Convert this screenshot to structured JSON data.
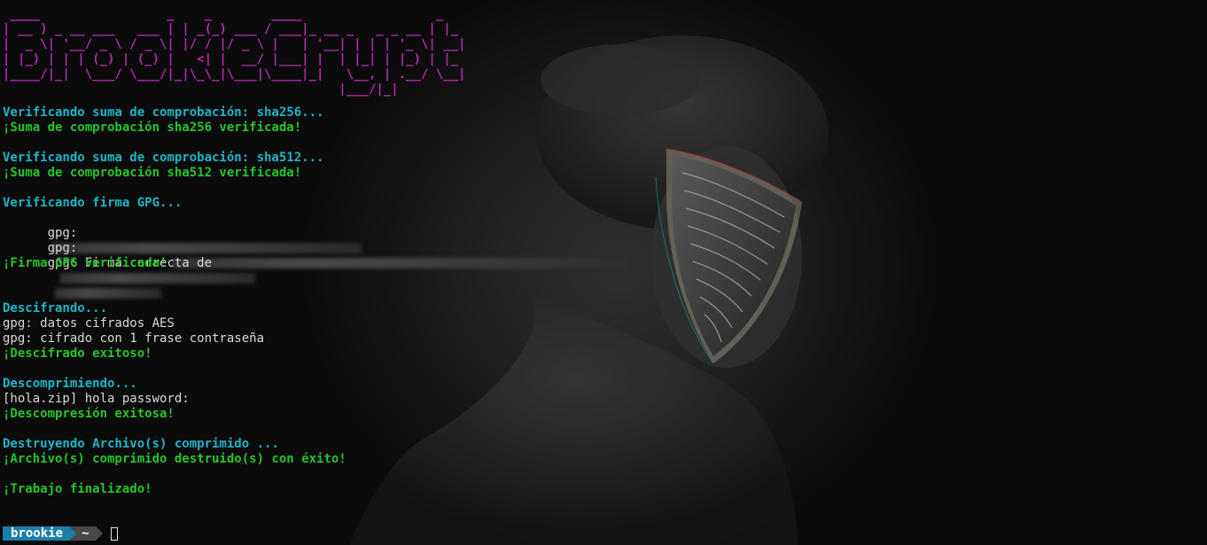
{
  "banner_art": " ____                 _    _        ____                  _\n| __ ) _ __ ___   ___ | | _(_) ___ / ___|_ __ _   _ _ __ | |_\n|  _ \\| '__/ _ \\ / _ \\| |/ / |/ _ \\ |   | '__| | | | '_ \\| __|\n| |_) | | | (_) | (_) |   <| |  __/ |___| |  | |_| | |_) | |_\n|____/|_|  \\___/ \\___/|_|\\_\\_|\\___|\\____|_|   \\__, | .__/ \\__|\n                                             |___/|_|",
  "lines": {
    "sha256_checking": "Verificando suma de comprobación: sha256...",
    "sha256_ok": "¡Suma de comprobación sha256 verificada!",
    "sha512_checking": "Verificando suma de comprobación: sha512...",
    "sha512_ok": "¡Suma de comprobación sha512 verificada!",
    "gpg_checking": "Verificando firma GPG...",
    "gpg_prefix_1": "gpg:",
    "gpg_prefix_2": "gpg:",
    "gpg_good_sig": "gpg: Firma correcta de",
    "gpg_ok": "¡Firma GPG verificada!",
    "decrypting": "Descifrando...",
    "aes_data": "gpg: datos cifrados AES",
    "passphrase": "gpg: cifrado con 1 frase contraseña",
    "decrypt_ok": "¡Descifrado exitoso!",
    "decompressing": "Descomprimiendo...",
    "zip_prompt": "[hola.zip] hola password:",
    "decompress_ok": "¡Descompresión exitosa!",
    "destroying": "Destruyendo Archivo(s) comprimido ...",
    "destroy_ok": "¡Archivo(s) comprimido destruido(s) con éxito!",
    "finished": "¡Trabajo finalizado!"
  },
  "prompt": {
    "user": "brookie",
    "dir": "~"
  },
  "colors": {
    "banner": "#b52ab5",
    "status_cyan": "#1fb6c9",
    "success_green": "#27c52a",
    "output_white": "#d9d9d9",
    "prompt_user_bg": "#1a7fa8",
    "prompt_dir_bg": "#4a4a4a"
  }
}
